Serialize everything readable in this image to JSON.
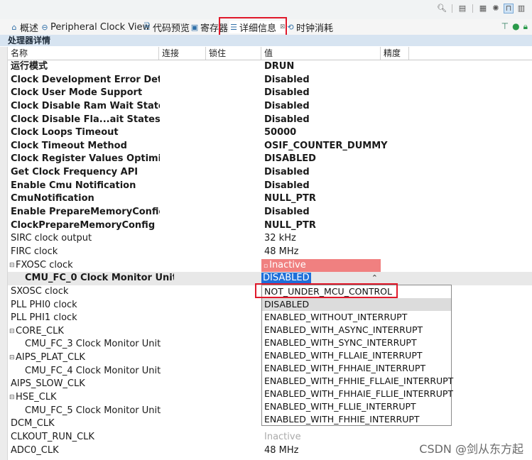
{
  "toolbar": {
    "icons": [
      "search-icon",
      "layout-icon",
      "outline-icon",
      "chip-icon",
      "pulse-icon",
      "grid-icon"
    ]
  },
  "tabs": [
    {
      "label": "概述",
      "icon": "home-icon"
    },
    {
      "label": "Peripheral Clock View",
      "icon": "clock-view-icon"
    },
    {
      "label": "代码预览",
      "icon": "code-preview-icon"
    },
    {
      "label": "寄存器",
      "icon": "register-icon"
    },
    {
      "label": "详细信息",
      "icon": "list-icon",
      "close": "⊠"
    },
    {
      "label": "时钟消耗",
      "icon": "gear-clock-icon"
    }
  ],
  "section_title": "处理器详情",
  "columns": [
    "名称",
    "连接",
    "锁住",
    "值",
    "精度"
  ],
  "rows": [
    {
      "name": "运行模式",
      "value": "DRUN"
    },
    {
      "name": "Clock Development Error Detect",
      "value": "Disabled"
    },
    {
      "name": "Clock User Mode Support",
      "value": "Disabled"
    },
    {
      "name": "Clock Disable Ram Wait States Co",
      "value": "Disabled"
    },
    {
      "name": "Clock Disable Fla...ait States Confi",
      "value": "Disabled"
    },
    {
      "name": "Clock Loops Timeout",
      "value": "50000"
    },
    {
      "name": "Clock Timeout Method",
      "value": "OSIF_COUNTER_DUMMY"
    },
    {
      "name": "Clock Register Values Optimizatio",
      "value": "DISABLED"
    },
    {
      "name": "Get Clock Frequency API",
      "value": "Disabled"
    },
    {
      "name": "Enable Cmu Notification",
      "value": "Disabled"
    },
    {
      "name": "CmuNotification",
      "value": "NULL_PTR"
    },
    {
      "name": "Enable PrepareMemoryConfig",
      "value": "Disabled"
    },
    {
      "name": "ClockPrepareMemoryConfig",
      "value": "NULL_PTR"
    },
    {
      "name": "SIRC clock output",
      "value": "32 kHz"
    },
    {
      "name": "FIRC clock",
      "value": "48 MHz"
    },
    {
      "name": "FXOSC clock",
      "value": "Inactive"
    },
    {
      "name": "CMU_FC_0 Clock Monitor Unit",
      "value": "DISABLED"
    },
    {
      "name": "SXOSC clock",
      "value": ""
    },
    {
      "name": "PLL PHI0 clock",
      "value": ""
    },
    {
      "name": "PLL PHI1 clock",
      "value": ""
    },
    {
      "name": "CORE_CLK",
      "value": ""
    },
    {
      "name": "CMU_FC_3 Clock Monitor Unit",
      "value": ""
    },
    {
      "name": "AIPS_PLAT_CLK",
      "value": ""
    },
    {
      "name": "CMU_FC_4 Clock Monitor Unit",
      "value": ""
    },
    {
      "name": "AIPS_SLOW_CLK",
      "value": ""
    },
    {
      "name": "HSE_CLK",
      "value": ""
    },
    {
      "name": "CMU_FC_5 Clock Monitor Unit",
      "value": ""
    },
    {
      "name": "DCM_CLK",
      "value": ""
    },
    {
      "name": "CLKOUT_RUN_CLK",
      "value": "Inactive"
    },
    {
      "name": "ADC0_CLK",
      "value": "48 MHz"
    }
  ],
  "dropdown": {
    "options": [
      "NOT_UNDER_MCU_CONTROL",
      "DISABLED",
      "ENABLED_WITHOUT_INTERRUPT",
      "ENABLED_WITH_ASYNC_INTERRUPT",
      "ENABLED_WITH_SYNC_INTERRUPT",
      "ENABLED_WITH_FLLAIE_INTERRUPT",
      "ENABLED_WITH_FHHAIE_INTERRUPT",
      "ENABLED_WITH_FHHIE_FLLAIE_INTERRUPT",
      "ENABLED_WITH_FHHAIE_FLLIE_INTERRUPT",
      "ENABLED_WITH_FLLIE_INTERRUPT",
      "ENABLED_WITH_FHHIE_INTERRUPT"
    ],
    "selected": "DISABLED"
  },
  "watermark": "CSDN @剑从东方起",
  "colors": {
    "accent": "#1e6fd9",
    "highlight_box": "#e0192b",
    "inactive_bg": "#f08080",
    "section_bg": "#d7e4f1"
  }
}
